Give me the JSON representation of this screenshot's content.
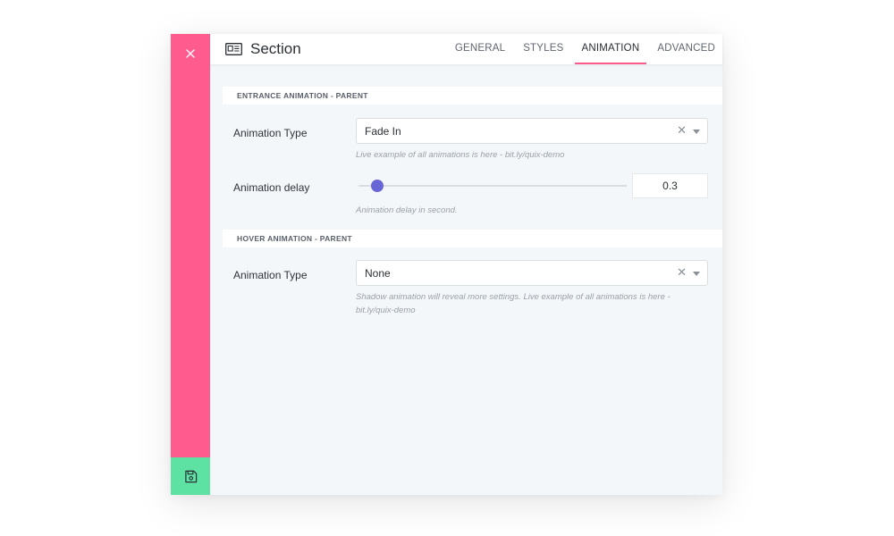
{
  "header": {
    "title": "Section",
    "icon": "section-icon",
    "tabs": [
      {
        "label": "GENERAL",
        "active": false
      },
      {
        "label": "STYLES",
        "active": false
      },
      {
        "label": "ANIMATION",
        "active": true
      },
      {
        "label": "ADVANCED",
        "active": false
      }
    ]
  },
  "sidebar": {
    "close_icon": "close-icon",
    "save_icon": "save-icon",
    "accent": "#ff5b8e",
    "save_color": "#5ee2a3"
  },
  "entrance": {
    "heading": "ENTRANCE ANIMATION - PARENT",
    "type_label": "Animation Type",
    "type_value": "Fade In",
    "type_help": "Live example of all animations is here - bit.ly/quix-demo",
    "delay_label": "Animation delay",
    "delay_value": "0.3",
    "delay_help": "Animation delay in second."
  },
  "hover": {
    "heading": "HOVER ANIMATION - PARENT",
    "type_label": "Animation Type",
    "type_value": "None",
    "type_help_1": "Shadow animation will reveal more settings. Live example of all animations is here -",
    "type_help_2": "bit.ly/quix-demo"
  },
  "colors": {
    "slider_thumb": "#6866d7",
    "active_tab_underline": "#ff5b8e"
  }
}
